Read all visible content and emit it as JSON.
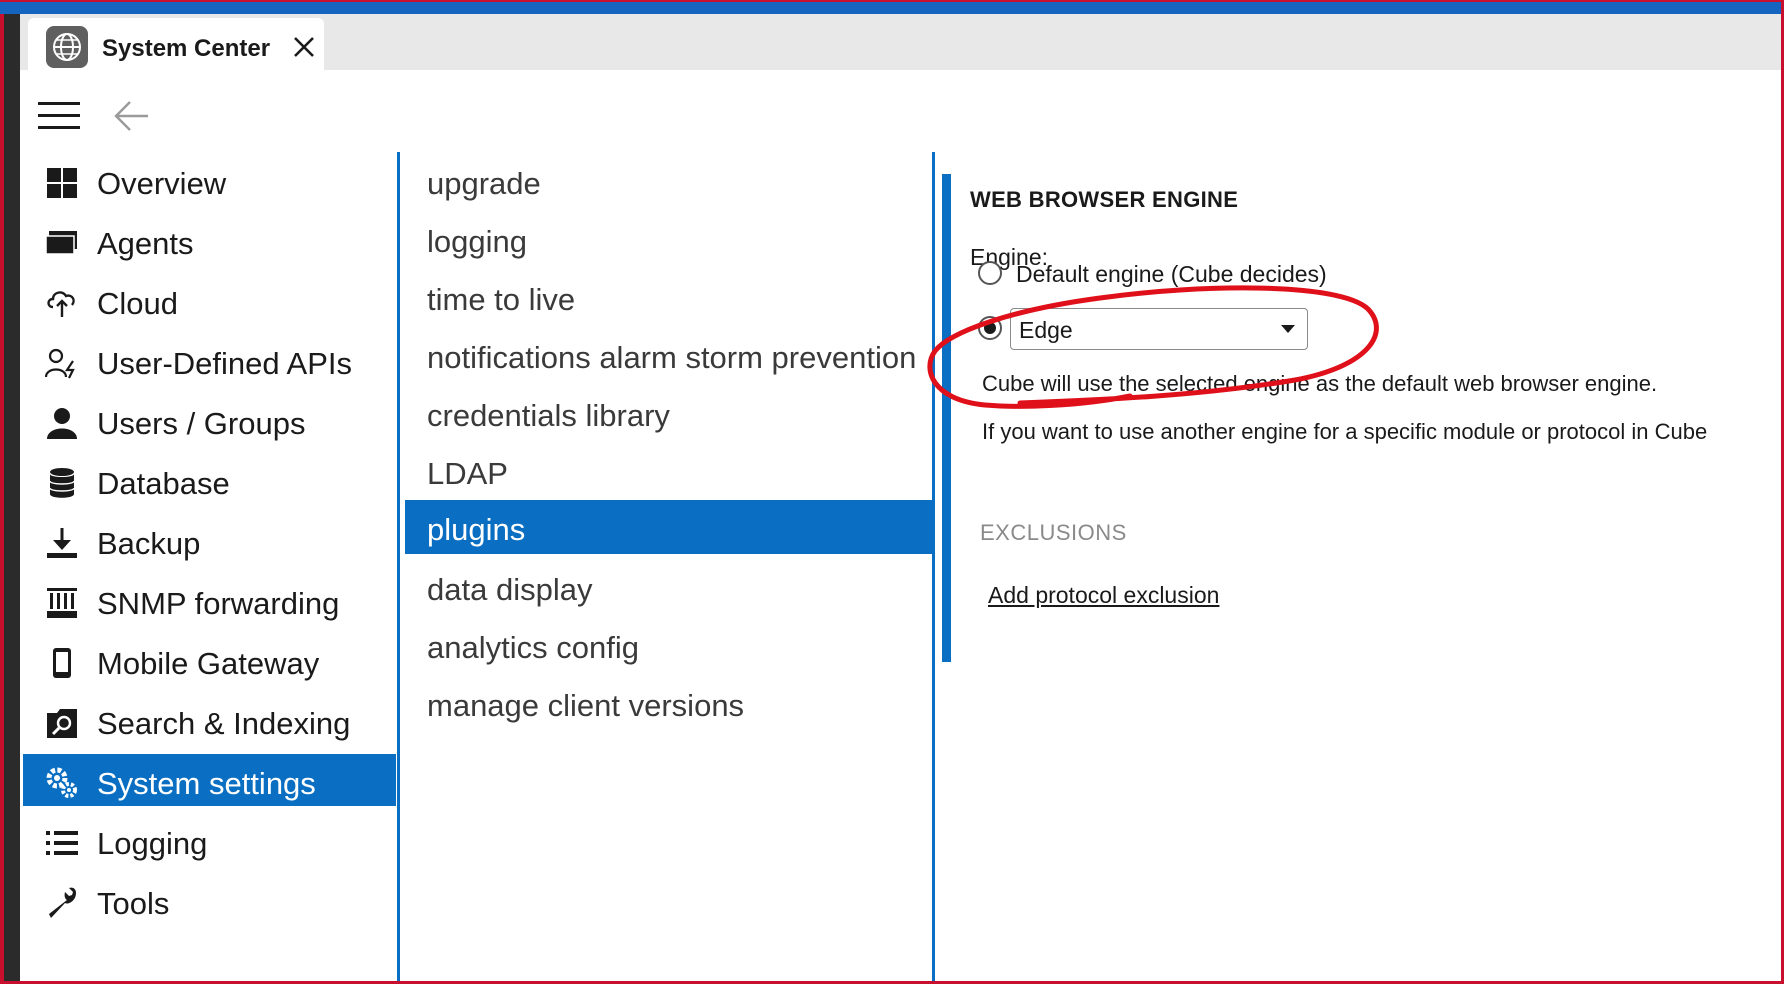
{
  "window": {
    "tab_title": "System Center"
  },
  "nav": {
    "items": [
      {
        "label": "Overview",
        "icon": "grid-icon"
      },
      {
        "label": "Agents",
        "icon": "agents-icon"
      },
      {
        "label": "Cloud",
        "icon": "cloud-icon"
      },
      {
        "label": "User-Defined APIs",
        "icon": "user-api-icon"
      },
      {
        "label": "Users / Groups",
        "icon": "user-icon"
      },
      {
        "label": "Database",
        "icon": "database-icon"
      },
      {
        "label": "Backup",
        "icon": "download-icon"
      },
      {
        "label": "SNMP forwarding",
        "icon": "snmp-icon"
      },
      {
        "label": "Mobile Gateway",
        "icon": "mobile-icon"
      },
      {
        "label": "Search & Indexing",
        "icon": "search-icon"
      },
      {
        "label": "System settings",
        "icon": "gears-icon",
        "active": true
      },
      {
        "label": "Logging",
        "icon": "list-icon"
      },
      {
        "label": "Tools",
        "icon": "wrench-icon"
      }
    ]
  },
  "submenu": {
    "items": [
      {
        "label": "upgrade"
      },
      {
        "label": "logging"
      },
      {
        "label": "time to live"
      },
      {
        "label": "notifications alarm storm prevention"
      },
      {
        "label": "credentials library"
      },
      {
        "label": "LDAP"
      },
      {
        "label": "plugins",
        "active": true
      },
      {
        "label": "data display"
      },
      {
        "label": "analytics config"
      },
      {
        "label": "manage client versions"
      }
    ]
  },
  "content": {
    "section_title": "WEB BROWSER ENGINE",
    "engine_label": "Engine:",
    "radio_default_label": "Default engine (Cube decides)",
    "selected_engine": "Edge",
    "desc_line1": "Cube will use the selected engine as the default web browser engine.",
    "desc_line2": "If you want to use another engine for a specific module or protocol in Cube",
    "exclusions_title": "EXCLUSIONS",
    "add_exclusion_label": "Add protocol exclusion"
  },
  "colors": {
    "accent": "#0a6fc2",
    "annotation": "#e0101a"
  }
}
